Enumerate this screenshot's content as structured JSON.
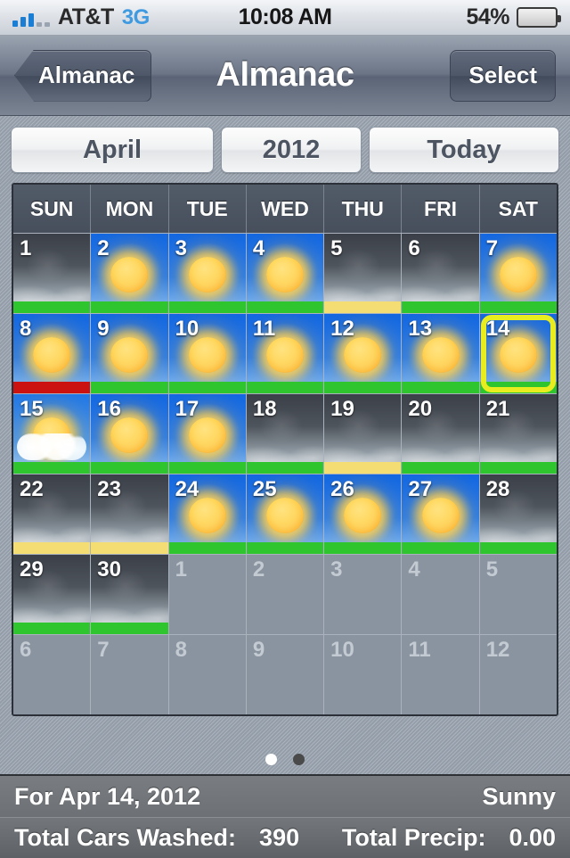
{
  "status_bar": {
    "carrier": "AT&T",
    "network": "3G",
    "time": "10:08 AM",
    "battery_percent": "54%",
    "battery_level": 54,
    "signal_bars_filled": 3,
    "signal_bars_total": 5
  },
  "nav_bar": {
    "back_label": "Almanac",
    "title": "Almanac",
    "right_label": "Select"
  },
  "segmented": {
    "month": "April",
    "year": "2012",
    "today": "Today"
  },
  "calendar": {
    "weekday_headers": [
      "SUN",
      "MON",
      "TUE",
      "WED",
      "THU",
      "FRI",
      "SAT"
    ],
    "weeks": [
      [
        {
          "num": "1",
          "sky": "cloudy",
          "icon": "cloudy-icon",
          "bar": "green",
          "out": false,
          "selected": false
        },
        {
          "num": "2",
          "sky": "sunny",
          "icon": "sun-icon",
          "bar": "green",
          "out": false,
          "selected": false
        },
        {
          "num": "3",
          "sky": "sunny",
          "icon": "sun-icon",
          "bar": "green",
          "out": false,
          "selected": false
        },
        {
          "num": "4",
          "sky": "sunny",
          "icon": "sun-icon",
          "bar": "green",
          "out": false,
          "selected": false
        },
        {
          "num": "5",
          "sky": "cloudy",
          "icon": "cloudy-icon",
          "bar": "yellow",
          "out": false,
          "selected": false
        },
        {
          "num": "6",
          "sky": "cloudy",
          "icon": "cloudy-icon",
          "bar": "green",
          "out": false,
          "selected": false
        },
        {
          "num": "7",
          "sky": "sunny",
          "icon": "sun-icon",
          "bar": "green",
          "out": false,
          "selected": false
        }
      ],
      [
        {
          "num": "8",
          "sky": "sunny",
          "icon": "sun-icon",
          "bar": "red",
          "out": false,
          "selected": false
        },
        {
          "num": "9",
          "sky": "sunny",
          "icon": "sun-icon",
          "bar": "green",
          "out": false,
          "selected": false
        },
        {
          "num": "10",
          "sky": "sunny",
          "icon": "sun-icon",
          "bar": "green",
          "out": false,
          "selected": false
        },
        {
          "num": "11",
          "sky": "sunny",
          "icon": "sun-icon",
          "bar": "green",
          "out": false,
          "selected": false
        },
        {
          "num": "12",
          "sky": "sunny",
          "icon": "sun-icon",
          "bar": "green",
          "out": false,
          "selected": false
        },
        {
          "num": "13",
          "sky": "sunny",
          "icon": "sun-icon",
          "bar": "green",
          "out": false,
          "selected": false
        },
        {
          "num": "14",
          "sky": "sunny",
          "icon": "sun-icon",
          "bar": "green",
          "out": false,
          "selected": true
        }
      ],
      [
        {
          "num": "15",
          "sky": "partly",
          "icon": "partly-sunny-icon",
          "bar": "green",
          "out": false,
          "selected": false
        },
        {
          "num": "16",
          "sky": "sunny",
          "icon": "sun-icon",
          "bar": "green",
          "out": false,
          "selected": false
        },
        {
          "num": "17",
          "sky": "sunny",
          "icon": "sun-icon",
          "bar": "green",
          "out": false,
          "selected": false
        },
        {
          "num": "18",
          "sky": "cloudy",
          "icon": "cloudy-icon",
          "bar": "green",
          "out": false,
          "selected": false
        },
        {
          "num": "19",
          "sky": "cloudy",
          "icon": "cloudy-icon",
          "bar": "yellow",
          "out": false,
          "selected": false
        },
        {
          "num": "20",
          "sky": "cloudy",
          "icon": "cloudy-icon",
          "bar": "green",
          "out": false,
          "selected": false
        },
        {
          "num": "21",
          "sky": "cloudy",
          "icon": "cloudy-icon",
          "bar": "green",
          "out": false,
          "selected": false
        }
      ],
      [
        {
          "num": "22",
          "sky": "cloudy",
          "icon": "cloudy-icon",
          "bar": "yellow",
          "out": false,
          "selected": false
        },
        {
          "num": "23",
          "sky": "cloudy",
          "icon": "cloudy-icon",
          "bar": "yellow",
          "out": false,
          "selected": false
        },
        {
          "num": "24",
          "sky": "sunny",
          "icon": "sun-icon",
          "bar": "green",
          "out": false,
          "selected": false
        },
        {
          "num": "25",
          "sky": "sunny",
          "icon": "sun-icon",
          "bar": "green",
          "out": false,
          "selected": false
        },
        {
          "num": "26",
          "sky": "sunny",
          "icon": "sun-icon",
          "bar": "green",
          "out": false,
          "selected": false
        },
        {
          "num": "27",
          "sky": "sunny",
          "icon": "sun-icon",
          "bar": "green",
          "out": false,
          "selected": false
        },
        {
          "num": "28",
          "sky": "cloudy",
          "icon": "cloudy-icon",
          "bar": "green",
          "out": false,
          "selected": false
        }
      ],
      [
        {
          "num": "29",
          "sky": "cloudy",
          "icon": "cloudy-icon",
          "bar": "green",
          "out": false,
          "selected": false
        },
        {
          "num": "30",
          "sky": "cloudy",
          "icon": "cloudy-icon",
          "bar": "green",
          "out": false,
          "selected": false
        },
        {
          "num": "1",
          "sky": "none",
          "icon": "none",
          "bar": "none",
          "out": true,
          "selected": false
        },
        {
          "num": "2",
          "sky": "none",
          "icon": "none",
          "bar": "none",
          "out": true,
          "selected": false
        },
        {
          "num": "3",
          "sky": "none",
          "icon": "none",
          "bar": "none",
          "out": true,
          "selected": false
        },
        {
          "num": "4",
          "sky": "none",
          "icon": "none",
          "bar": "none",
          "out": true,
          "selected": false
        },
        {
          "num": "5",
          "sky": "none",
          "icon": "none",
          "bar": "none",
          "out": true,
          "selected": false
        }
      ],
      [
        {
          "num": "6",
          "sky": "none",
          "icon": "none",
          "bar": "none",
          "out": true,
          "selected": false
        },
        {
          "num": "7",
          "sky": "none",
          "icon": "none",
          "bar": "none",
          "out": true,
          "selected": false
        },
        {
          "num": "8",
          "sky": "none",
          "icon": "none",
          "bar": "none",
          "out": true,
          "selected": false
        },
        {
          "num": "9",
          "sky": "none",
          "icon": "none",
          "bar": "none",
          "out": true,
          "selected": false
        },
        {
          "num": "10",
          "sky": "none",
          "icon": "none",
          "bar": "none",
          "out": true,
          "selected": false
        },
        {
          "num": "11",
          "sky": "none",
          "icon": "none",
          "bar": "none",
          "out": true,
          "selected": false
        },
        {
          "num": "12",
          "sky": "none",
          "icon": "none",
          "bar": "none",
          "out": true,
          "selected": false
        }
      ]
    ]
  },
  "page_dots": {
    "count": 2,
    "active_index": 0
  },
  "info": {
    "date_label": "For Apr 14, 2012",
    "condition": "Sunny",
    "cars_washed_label": "Total Cars Washed:",
    "cars_washed_value": "390",
    "precip_label": "Total Precip:",
    "precip_value": "0.00"
  },
  "colors": {
    "bar_green": "#2fc52f",
    "bar_yellow": "#f4dd72",
    "bar_red": "#cc1111",
    "selection_ring": "#e9ec1f",
    "accent_blue": "#3f9ae0"
  }
}
